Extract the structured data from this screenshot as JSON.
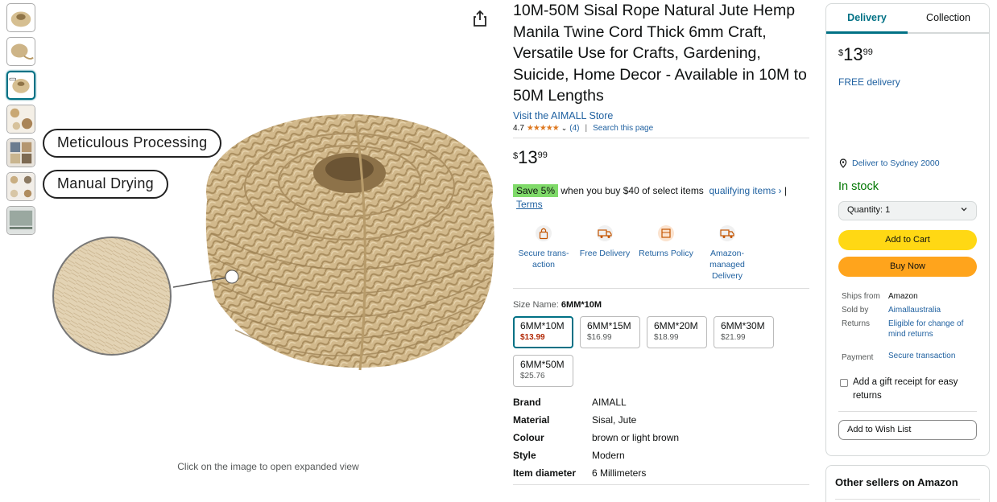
{
  "product": {
    "title": "10M-50M Sisal Rope Natural Jute Hemp Manila Twine Cord Thick 6mm Craft, Versatile Use for Crafts, Gardening, Suicide, Home Decor - Available in 10M to 50M Lengths",
    "store_link": "Visit the AIMALL Store",
    "rating": "4.7",
    "rating_stars": "★★★★★",
    "rating_count": "(4)",
    "search_link": "Search this page",
    "price": {
      "currency": "$",
      "whole": "13",
      "fraction": "99"
    },
    "promo": {
      "badge": "Save 5%",
      "text": "when you buy $40 of select items",
      "link": "qualifying items ›",
      "sep": "|",
      "terms": "Terms"
    },
    "features": [
      {
        "label": "Secure trans-action",
        "icon": "lock-icon"
      },
      {
        "label": "Free Delivery",
        "icon": "truck-icon"
      },
      {
        "label": "Returns Policy",
        "icon": "return-box-icon"
      },
      {
        "label": "Amazon-managed Delivery",
        "icon": "truck-icon"
      }
    ],
    "size_label": "Size Name:",
    "size_selected": "6MM*10M",
    "sizes": [
      {
        "name": "6MM*10M",
        "price": "$13.99"
      },
      {
        "name": "6MM*15M",
        "price": "$16.99"
      },
      {
        "name": "6MM*20M",
        "price": "$18.99"
      },
      {
        "name": "6MM*30M",
        "price": "$21.99"
      },
      {
        "name": "6MM*50M",
        "price": "$25.76"
      }
    ],
    "specs": [
      {
        "key": "Brand",
        "value": "AIMALL"
      },
      {
        "key": "Material",
        "value": "Sisal, Jute"
      },
      {
        "key": "Colour",
        "value": "brown or light brown"
      },
      {
        "key": "Style",
        "value": "Modern"
      },
      {
        "key": "Item diameter",
        "value": "6 Millimeters"
      }
    ]
  },
  "image": {
    "callout_1": "Meticulous Processing",
    "callout_2": "Manual Drying",
    "expand_hint": "Click on the image to open expanded view"
  },
  "buybox": {
    "tabs": [
      "Delivery",
      "Collection"
    ],
    "price": {
      "currency": "$",
      "whole": "13",
      "fraction": "99"
    },
    "free_delivery": "FREE delivery",
    "deliver_to": "Deliver to Sydney 2000",
    "stock": "In stock",
    "quantity": "Quantity: 1",
    "add_to_cart": "Add to Cart",
    "buy_now": "Buy Now",
    "ships_from_label": "Ships from",
    "ships_from": "Amazon",
    "sold_by_label": "Sold by",
    "sold_by": "Aimallaustralia",
    "returns_label": "Returns",
    "returns": "Eligible for change of mind returns",
    "payment_label": "Payment",
    "payment": "Secure transaction",
    "gift": "Add a gift receipt for easy returns",
    "wishlist": "Add to Wish List",
    "other_sellers": "Other sellers on Amazon"
  },
  "colors": {
    "accent": "#007185",
    "link": "#2162a1",
    "cart": "#ffd814",
    "buy": "#ffa41c",
    "stock": "#007600",
    "promo": "#7fda69"
  }
}
